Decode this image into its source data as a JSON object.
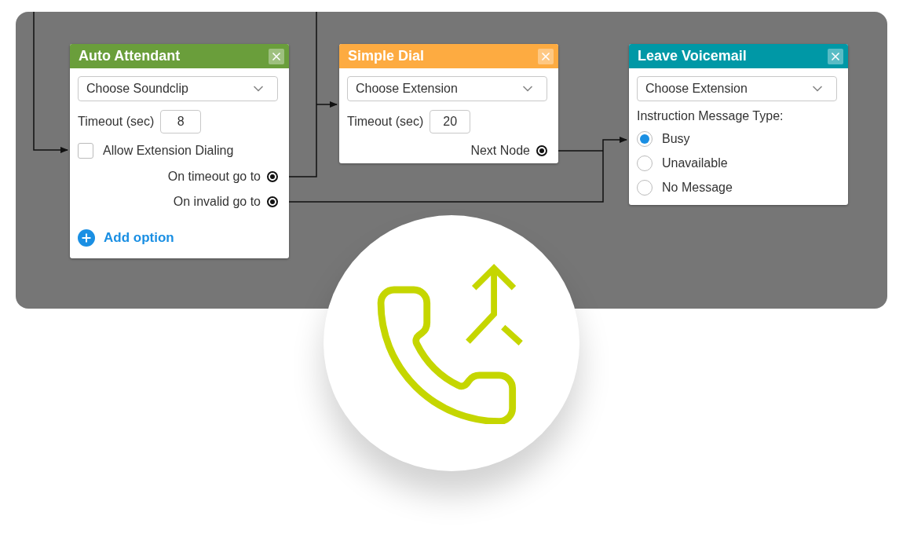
{
  "nodes": [
    {
      "kind": "auto_attendant",
      "title": "Auto Attendant",
      "color": "#6a9e3b",
      "rows": [
        {
          "kind": "select",
          "text": "Choose Soundclip"
        },
        {
          "kind": "timeout",
          "label": "Timeout (sec)",
          "value": "8"
        },
        {
          "kind": "checkbox",
          "label": "Allow Extension Dialing",
          "checked": false
        },
        {
          "kind": "output",
          "label": "On timeout go to"
        },
        {
          "kind": "output",
          "label": "On invalid go to"
        },
        {
          "kind": "add",
          "label": "Add option"
        }
      ]
    },
    {
      "kind": "simple_dial",
      "title": "Simple Dial",
      "color": "#fdab41",
      "rows": [
        {
          "kind": "select",
          "text": "Choose Extension"
        },
        {
          "kind": "timeout",
          "label": "Timeout (sec)",
          "value": "20"
        },
        {
          "kind": "output",
          "label": "Next Node"
        }
      ]
    },
    {
      "kind": "voicemail",
      "title": "Leave Voicemail",
      "color": "#0098a6",
      "rows": [
        {
          "kind": "select",
          "text": "Choose Extension"
        },
        {
          "kind": "label",
          "label": "Instruction Message Type:"
        },
        {
          "kind": "radio",
          "label": "Busy",
          "selected": true
        },
        {
          "kind": "radio",
          "label": "Unavailable",
          "selected": false
        },
        {
          "kind": "radio",
          "label": "No Message",
          "selected": false
        }
      ]
    }
  ]
}
